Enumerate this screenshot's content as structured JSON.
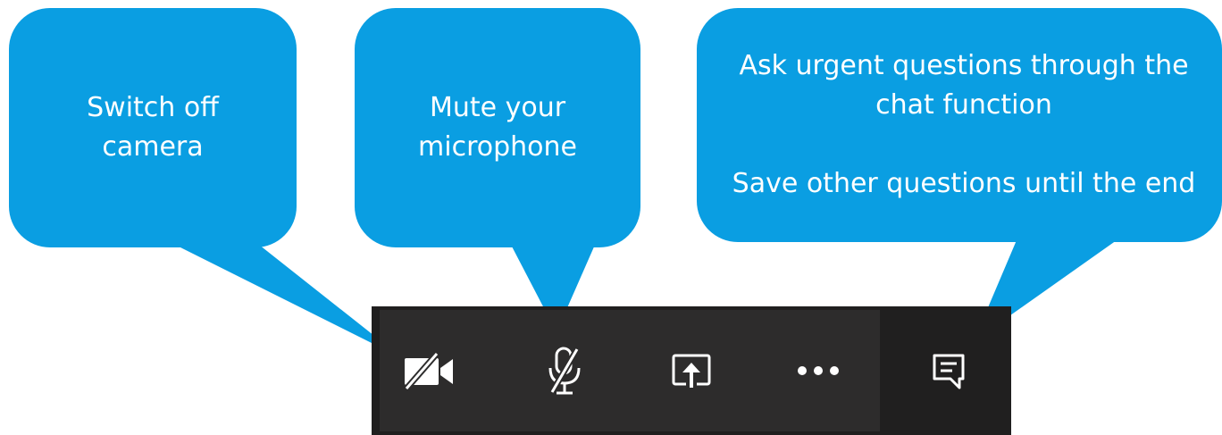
{
  "callouts": {
    "camera": {
      "lines": [
        "Switch off",
        "camera"
      ]
    },
    "microphone": {
      "lines": [
        "Mute your",
        "microphone"
      ]
    },
    "chat": {
      "lines": [
        "Ask urgent questions through the",
        "chat function"
      ],
      "secondary": "Save other questions until the end"
    }
  },
  "toolbar": {
    "buttons": [
      {
        "id": "camera",
        "icon": "camera-off-icon",
        "state": "off"
      },
      {
        "id": "microphone",
        "icon": "microphone-off-icon",
        "state": "muted"
      },
      {
        "id": "share",
        "icon": "share-screen-icon"
      },
      {
        "id": "more",
        "icon": "more-options-icon"
      },
      {
        "id": "chat",
        "icon": "chat-icon"
      }
    ]
  },
  "colors": {
    "callout": "#0a9ee2",
    "callout_text": "#ffffff",
    "toolbar": "#2d2c2c",
    "toolbar_dark": "#201f1f",
    "icon": "#ffffff"
  }
}
